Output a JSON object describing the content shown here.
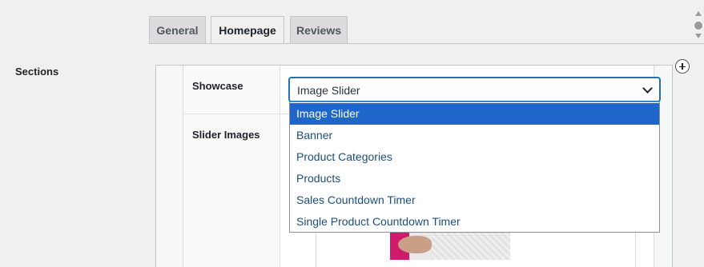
{
  "tabs": [
    {
      "label": "General",
      "active": false
    },
    {
      "label": "Homepage",
      "active": true
    },
    {
      "label": "Reviews",
      "active": false
    }
  ],
  "sections_label": "Sections",
  "fields": {
    "showcase_label": "Showcase",
    "slider_images_label": "Slider Images"
  },
  "showcase_select": {
    "value": "Image Slider",
    "options": [
      {
        "label": "Image Slider",
        "selected": true
      },
      {
        "label": "Banner",
        "selected": false
      },
      {
        "label": "Product Categories",
        "selected": false
      },
      {
        "label": "Products",
        "selected": false
      },
      {
        "label": "Sales Countdown Timer",
        "selected": false
      },
      {
        "label": "Single Product Countdown Timer",
        "selected": false
      }
    ]
  },
  "icons": {
    "add": "plus-circle-icon",
    "dropdown": "chevron-down-icon"
  },
  "colors": {
    "accent": "#2271b1",
    "highlight": "#1e66c9"
  }
}
